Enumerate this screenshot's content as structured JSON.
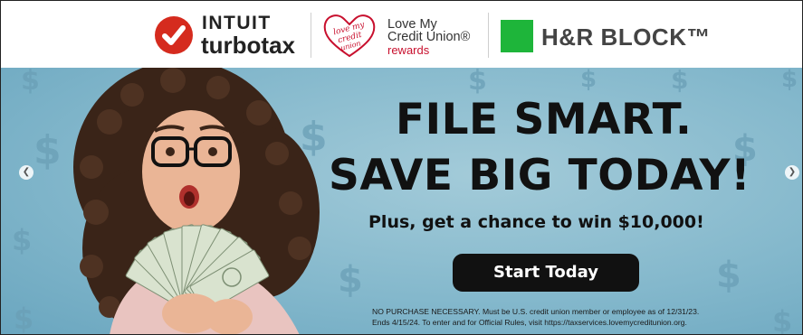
{
  "logos": {
    "turbotax": {
      "line1": "INTUIT",
      "line2": "turbotax"
    },
    "love_my_credit_union": {
      "line1": "Love My",
      "line2": "Credit Union®",
      "line3": "rewards"
    },
    "hr_block": {
      "name": "H&R BLOCK™"
    }
  },
  "banner": {
    "headline_line1": "FILE SMART.",
    "headline_line2": "SAVE BIG TODAY!",
    "subheadline": "Plus, get a chance to win $10,000!",
    "cta_label": "Start Today",
    "disclaimer_line1": "NO PURCHASE NECESSARY. Must be U.S. credit union member or employee as of 12/31/23.",
    "disclaimer_line2": "Ends 4/15/24. To enter and for Official Rules, visit https://taxservices.lovemycreditunion.org."
  },
  "carousel": {
    "prev_icon": "chevron-left-icon",
    "next_icon": "chevron-right-icon"
  },
  "colors": {
    "turbotax_red": "#d52b1e",
    "hr_green": "#1eb53a",
    "banner_bg": "#84b8cc",
    "cta_bg": "#111111"
  }
}
